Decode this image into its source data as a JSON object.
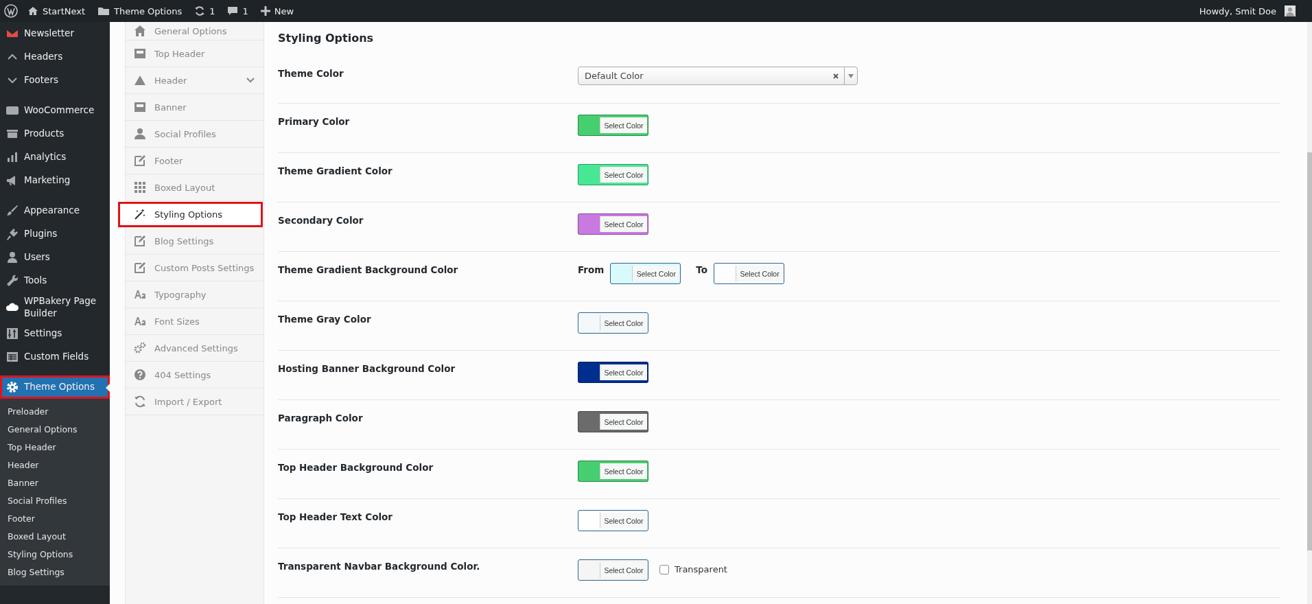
{
  "admin_bar": {
    "site": "StartNext",
    "theme_options": "Theme Options",
    "updates": "1",
    "comments": "1",
    "new": "New",
    "greeting": "Howdy, Smit Doe"
  },
  "admin_menu": [
    [
      {
        "label": "Newsletter",
        "selected": false
      },
      {
        "label": "Headers",
        "selected": false
      },
      {
        "label": "Footers",
        "selected": false
      }
    ],
    [
      {
        "label": "WooCommerce",
        "selected": false
      },
      {
        "label": "Products",
        "selected": false
      },
      {
        "label": "Analytics",
        "selected": false
      },
      {
        "label": "Marketing",
        "selected": false
      }
    ],
    [
      {
        "label": "Appearance",
        "selected": false
      },
      {
        "label": "Plugins",
        "selected": false
      },
      {
        "label": "Users",
        "selected": false
      },
      {
        "label": "Tools",
        "selected": false
      },
      {
        "label": "WPBakery Page Builder",
        "selected": false
      },
      {
        "label": "Settings",
        "selected": false
      },
      {
        "label": "Custom Fields",
        "selected": false
      }
    ],
    [
      {
        "label": "Theme Options",
        "selected": true
      }
    ]
  ],
  "submenu": [
    "Preloader",
    "General Options",
    "Top Header",
    "Header",
    "Banner",
    "Social Profiles",
    "Footer",
    "Boxed Layout",
    "Styling Options",
    "Blog Settings"
  ],
  "options_nav": [
    {
      "label": "General Options",
      "selected": false
    },
    {
      "label": "Top Header",
      "selected": false
    },
    {
      "label": "Header",
      "selected": false
    },
    {
      "label": "Banner",
      "selected": false
    },
    {
      "label": "Social Profiles",
      "selected": false
    },
    {
      "label": "Footer",
      "selected": false
    },
    {
      "label": "Boxed Layout",
      "selected": false
    },
    {
      "label": "Styling Options",
      "selected": true
    },
    {
      "label": "Blog Settings",
      "selected": false
    },
    {
      "label": "Custom Posts Settings",
      "selected": false
    },
    {
      "label": "Typography",
      "selected": false
    },
    {
      "label": "Font Sizes",
      "selected": false
    },
    {
      "label": "Advanced Settings",
      "selected": false
    },
    {
      "label": "404 Settings",
      "selected": false
    },
    {
      "label": "Import / Export",
      "selected": false
    }
  ],
  "section_title": "Styling Options",
  "fields": [
    {
      "kind": "select",
      "label": "Theme Color",
      "value": "Default Color"
    },
    {
      "kind": "color",
      "label": "Primary Color",
      "button": "Select Color",
      "color": "#46cf6f"
    },
    {
      "kind": "color",
      "label": "Theme Gradient Color",
      "button": "Select Color",
      "color": "#47e894"
    },
    {
      "kind": "color",
      "label": "Secondary Color",
      "button": "Select Color",
      "color": "#c87ae0"
    },
    {
      "kind": "gradient",
      "label": "Theme Gradient Background Color",
      "from_label": "From",
      "from": {
        "button": "Select Color",
        "color": "#d8fafa"
      },
      "to_label": "To",
      "to": {
        "button": "Select Color",
        "color": "#fdfcff"
      }
    },
    {
      "kind": "color",
      "label": "Theme Gray Color",
      "button": "Select Color",
      "color": "#f4f8fb"
    },
    {
      "kind": "color",
      "label": "Hosting Banner Background Color",
      "button": "Select Color",
      "color": "#002e8f"
    },
    {
      "kind": "color",
      "label": "Paragraph Color",
      "button": "Select Color",
      "color": "#6b6b6b"
    },
    {
      "kind": "color",
      "label": "Top Header Background Color",
      "button": "Select Color",
      "color": "#46cf6f"
    },
    {
      "kind": "color",
      "label": "Top Header Text Color",
      "button": "Select Color",
      "color": "#ffffff"
    },
    {
      "kind": "color_checkbox",
      "label": "Transparent Navbar Background Color.",
      "button": "Select Color",
      "color": "#f5f5f5",
      "checkbox": {
        "label": "Transparent",
        "checked": false
      }
    }
  ]
}
